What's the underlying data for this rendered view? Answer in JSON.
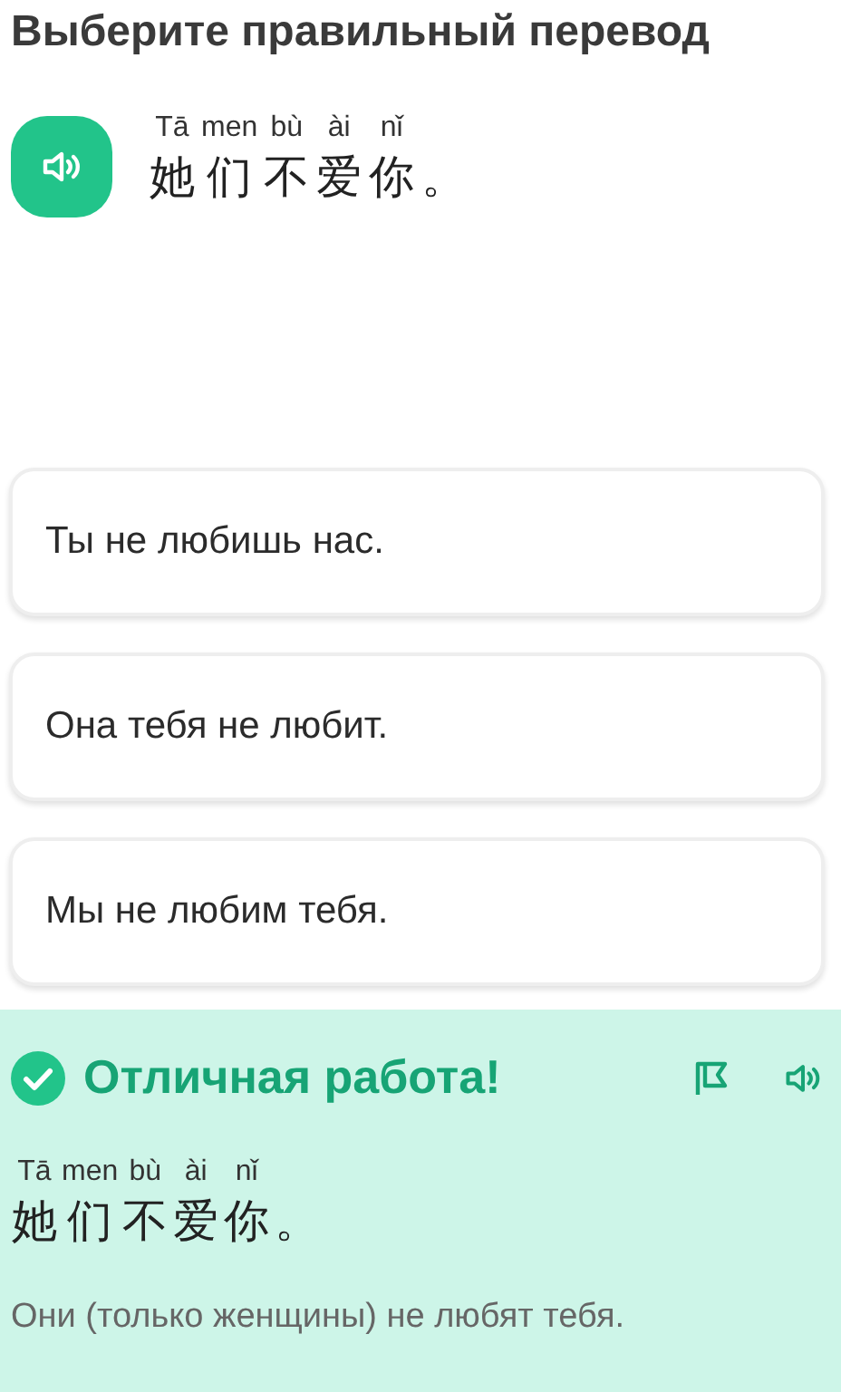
{
  "title": "Выберите правильный перевод",
  "prompt": {
    "syllables": [
      {
        "pinyin": "Tā",
        "hanzi": "她"
      },
      {
        "pinyin": "men",
        "hanzi": "们"
      },
      {
        "pinyin": "bù",
        "hanzi": "不"
      },
      {
        "pinyin": "ài",
        "hanzi": "爱"
      },
      {
        "pinyin": "nǐ",
        "hanzi": "你"
      },
      {
        "hanzi": "。"
      }
    ]
  },
  "options": [
    {
      "text": "Ты не любишь нас.",
      "selected": false
    },
    {
      "text": "Она тебя не любит.",
      "selected": false
    },
    {
      "text": "Мы не любим тебя.",
      "selected": false
    }
  ],
  "feedback": {
    "correct": true,
    "heading": "Отличная работа!",
    "syllables": [
      {
        "pinyin": "Tā",
        "hanzi": "她"
      },
      {
        "pinyin": "men",
        "hanzi": "们"
      },
      {
        "pinyin": "bù",
        "hanzi": "不"
      },
      {
        "pinyin": "ài",
        "hanzi": "爱"
      },
      {
        "pinyin": "nǐ",
        "hanzi": "你"
      },
      {
        "hanzi": "。"
      }
    ],
    "translation": "Они (только женщины) не любят тебя."
  }
}
